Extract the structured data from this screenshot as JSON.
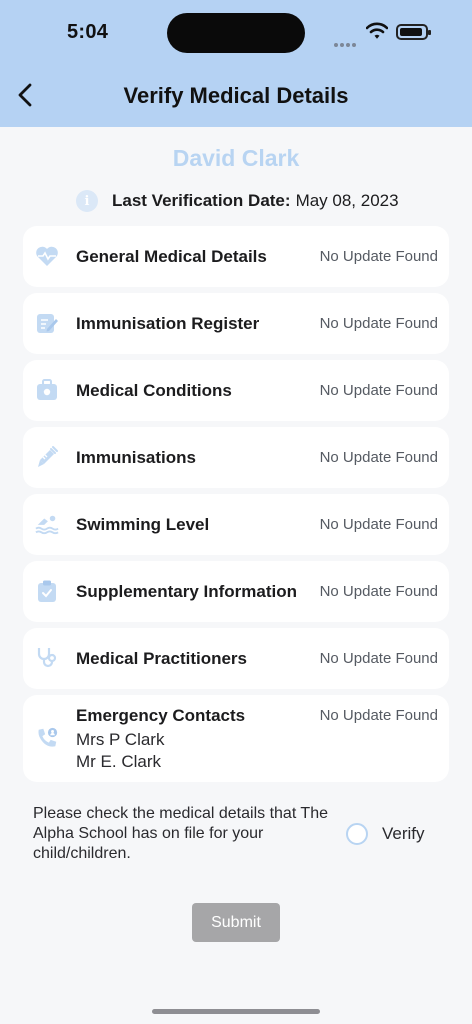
{
  "status_bar": {
    "time": "5:04"
  },
  "header": {
    "title": "Verify Medical Details"
  },
  "student": {
    "name": "David Clark"
  },
  "verification": {
    "label": "Last Verification Date:",
    "date": "May 08, 2023"
  },
  "sections": [
    {
      "title": "General Medical Details",
      "status": "No Update Found",
      "icon": "heart-icon"
    },
    {
      "title": "Immunisation Register",
      "status": "No Update Found",
      "icon": "edit-note-icon"
    },
    {
      "title": "Medical Conditions",
      "status": "No Update Found",
      "icon": "medical-bag-icon"
    },
    {
      "title": "Immunisations",
      "status": "No Update Found",
      "icon": "syringe-icon"
    },
    {
      "title": "Swimming Level",
      "status": "No Update Found",
      "icon": "swimmer-icon"
    },
    {
      "title": "Supplementary Information",
      "status": "No Update Found",
      "icon": "clipboard-check-icon"
    },
    {
      "title": "Medical Practitioners",
      "status": "No Update Found",
      "icon": "stethoscope-icon"
    },
    {
      "title": "Emergency Contacts",
      "status": "No Update Found",
      "icon": "phone-contact-icon",
      "contacts": [
        "Mrs P Clark",
        "Mr E. Clark"
      ]
    }
  ],
  "confirmation": {
    "text": "Please check the medical details that The Alpha School has on file for your child/children.",
    "verify_label": "Verify",
    "checked": false
  },
  "submit_label": "Submit",
  "colors": {
    "header_bg": "#b5d2f3",
    "accent": "#b8d4f2",
    "icon": "#c3daf3",
    "submit_disabled": "#a6a6a8"
  }
}
